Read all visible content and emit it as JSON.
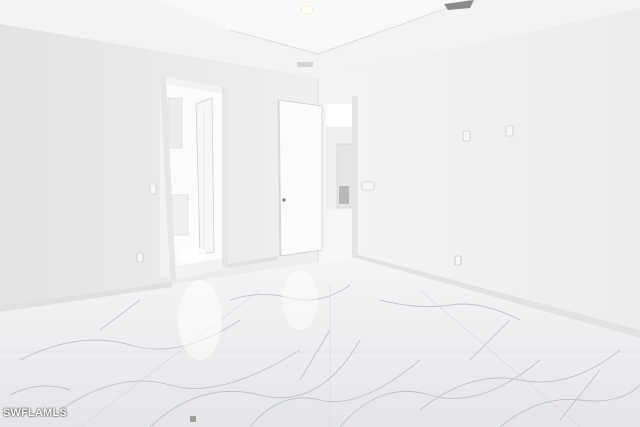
{
  "watermark": {
    "text": "SWFLAMLS"
  },
  "colors": {
    "wall_left": "#ededed",
    "wall_right": "#f1f1f1",
    "ceiling": "#f6f6f6",
    "floor": "#eeeef0",
    "baseboard": "#e2e2e2",
    "door": "#fafafa",
    "light": "#fffef6"
  }
}
